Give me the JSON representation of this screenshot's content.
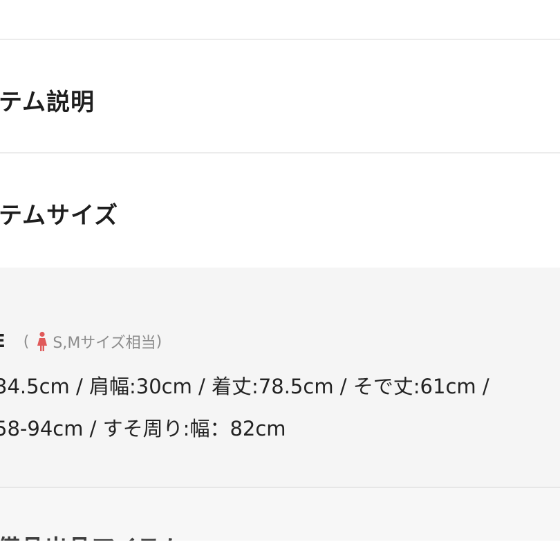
{
  "sections": {
    "description_title": "テム説明",
    "size_title": "テムサイズ"
  },
  "size_info": {
    "label": "E",
    "note_open": "(",
    "note_text": "S,Mサイズ相当",
    "note_close": ")",
    "line1": "34.5cm / 肩幅:30cm / 着丈:78.5cm / そで丈:61cm /",
    "line2": "58-94cm / すそ周り:幅：82cm",
    "icon": "woman-icon",
    "icon_color": "#e05a5a"
  },
  "next_section": {
    "title": "備品出品アイテム"
  },
  "colors": {
    "panel_bg": "#f5f5f5",
    "divider": "#ececec",
    "note_text": "#8c8c8c"
  }
}
